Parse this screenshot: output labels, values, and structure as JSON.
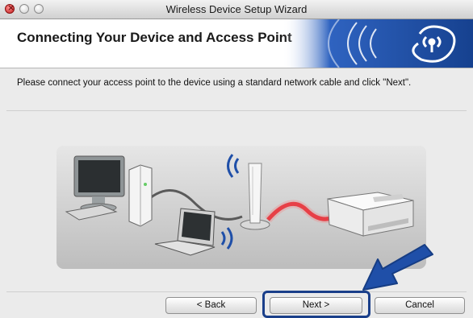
{
  "window": {
    "title": "Wireless Device Setup Wizard"
  },
  "header": {
    "title": "Connecting Your Device and Access Point"
  },
  "instruction": "Please connect your access point to the device using a standard network cable and click \"Next\".",
  "buttons": {
    "back": "< Back",
    "next": "Next >",
    "cancel": "Cancel"
  },
  "colors": {
    "header_banner": "#1f4fa8",
    "highlight": "#1a3f8a",
    "cable": "#e0202a",
    "wave": "#1f4fa8"
  },
  "icons": {
    "header_logo": "wireless-logo-icon",
    "arrow": "pointer-arrow-icon"
  }
}
